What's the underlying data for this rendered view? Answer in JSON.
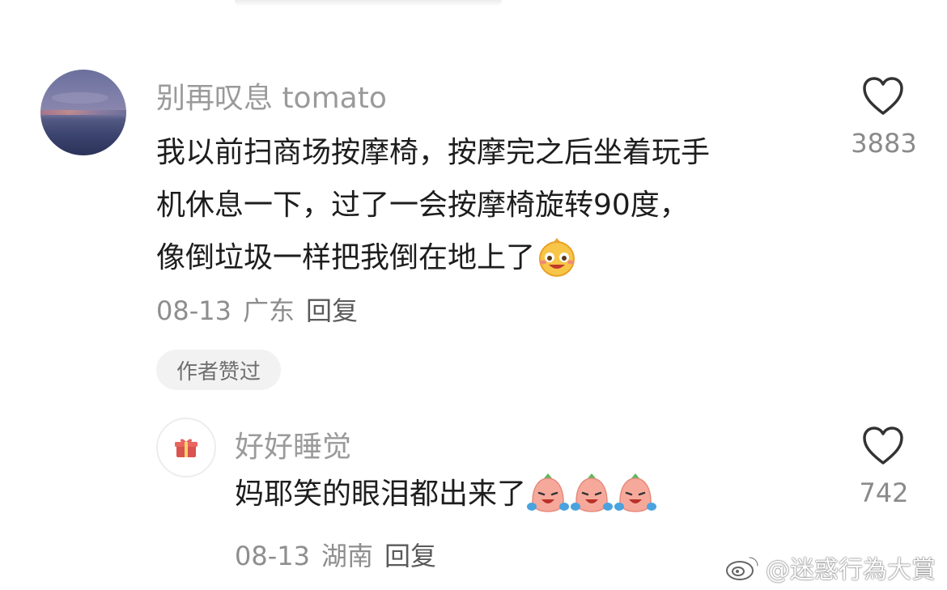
{
  "comment": {
    "username": "别再叹息 tomato",
    "lines": [
      "我以前扫商场按摩椅，按摩完之后坐着玩手",
      "机休息一下，过了一会按摩椅旋转90度，",
      "像倒垃圾一样把我倒在地上了"
    ],
    "emoji_icon": "laughing-tears-emoji-icon",
    "date": "08-13",
    "location": "广东",
    "reply_label": "回复",
    "badge": "作者赞过",
    "likes": "3883"
  },
  "reply": {
    "username": "好好睡觉",
    "text": "妈耶笑的眼泪都出来了",
    "emoji_icons": [
      "crying-laugh-emoji-icon",
      "crying-laugh-emoji-icon",
      "crying-laugh-emoji-icon"
    ],
    "avatar_icon": "gift-icon",
    "date": "08-13",
    "location": "湖南",
    "reply_label": "回复",
    "likes": "742"
  },
  "watermark": {
    "text": "@迷惑行為大賞",
    "icon": "weibo-logo-icon"
  },
  "colors": {
    "name_gray": "#9a9a9a",
    "text_dark": "#1d1d1d",
    "badge_bg": "#f2f2f2",
    "heart_stroke": "#333333"
  }
}
